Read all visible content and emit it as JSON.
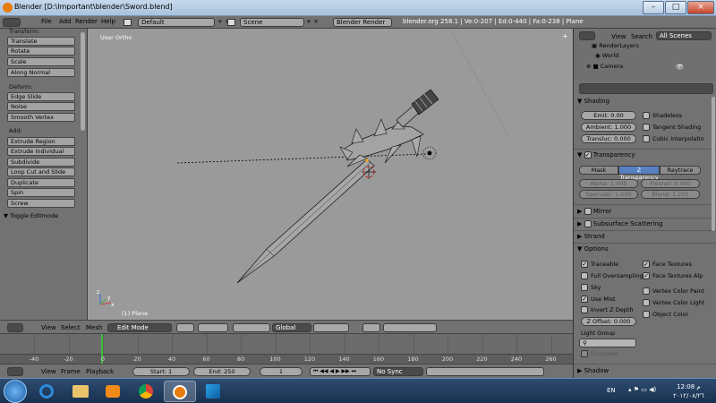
{
  "window": {
    "title": "Blender  [D:\\Important\\blender\\Sword.blend]",
    "minimize": "–",
    "maximize": "□",
    "close": "×"
  },
  "info_header": {
    "menus": [
      "File",
      "Add",
      "Render",
      "Help"
    ],
    "layout": "Default",
    "scene": "Scene",
    "engine": "Blender Render",
    "stats": "blender.org 258.1 | Ve:0-207 | Ed:0-440 | Fa:0-238 | Plane"
  },
  "toolshelf": {
    "transform_label": "Transform:",
    "transform": [
      "Translate",
      "Rotate",
      "Scale",
      "Along Normal"
    ],
    "deform_label": "Deform:",
    "deform": [
      "Edge Slide",
      "Noise",
      "Smooth Vertex"
    ],
    "add_label": "Add:",
    "add": [
      "Extrude Region",
      "Extrude Individual",
      "Subdivide",
      "Loop Cut and Slide",
      "Duplicate",
      "Spin",
      "Screw"
    ],
    "toggle": "Toggle Editmode"
  },
  "viewport": {
    "view_label": "User Ortho",
    "object_label": "(1) Plane"
  },
  "view3d_header": {
    "menus": [
      "View",
      "Select",
      "Mesh"
    ],
    "mode": "Edit Mode",
    "orientation": "Global"
  },
  "timeline": {
    "ticks": [
      "-40",
      "-20",
      "0",
      "20",
      "40",
      "60",
      "80",
      "100",
      "120",
      "140",
      "160",
      "180",
      "200",
      "220",
      "240",
      "260"
    ],
    "current_frame_marker": 1
  },
  "timeline_header": {
    "menus": [
      "View",
      "Frame",
      "Playback"
    ],
    "start": "Start: 1",
    "end": "End: 250",
    "current": "1",
    "sync": "No Sync"
  },
  "outliner": {
    "menus": [
      "View",
      "Search"
    ],
    "filter": "All Scenes",
    "items": [
      "RenderLayers",
      "World",
      "Camera"
    ]
  },
  "properties": {
    "shading_title": "Shading",
    "emit": "Emit: 0.00",
    "ambient": "Ambient: 1.000",
    "transluc": "Transluc: 0.000",
    "shadeless": "Shadeless",
    "tangent": "Tangent Shading",
    "cubic": "Cubic Interpolatio",
    "transparency_title": "Transparency",
    "transp_modes": [
      "Mask",
      "Z Transparency",
      "Raytrace"
    ],
    "alpha": "Alpha: 1.000",
    "fresnel": "Fresnel: 0.000",
    "specular": "Specular: 1.000",
    "blend": "Blend: 1.250",
    "mirror": "Mirror",
    "sss": "Subsurface Scattering",
    "strand": "Strand",
    "options_title": "Options",
    "traceable": "Traceable",
    "full_os": "Full Oversampling",
    "sky": "Sky",
    "use_mist": "Use Mist",
    "invert_z": "Invert Z Depth",
    "z_offset": "Z Offset: 0.000",
    "face_textures": "Face Textures",
    "face_textures_alpha": "Face Textures Alp",
    "vc_paint": "Vertex Color Paint",
    "vc_light": "Vertex Color Light",
    "object_color": "Object Color",
    "light_group_label": "Light Group",
    "exclusive": "Exclusive",
    "shadow_title": "Shadow"
  },
  "taskbar": {
    "lang": "EN",
    "time": "12:08 م",
    "date": "٢٠١٢/٠٨/٢٦"
  }
}
